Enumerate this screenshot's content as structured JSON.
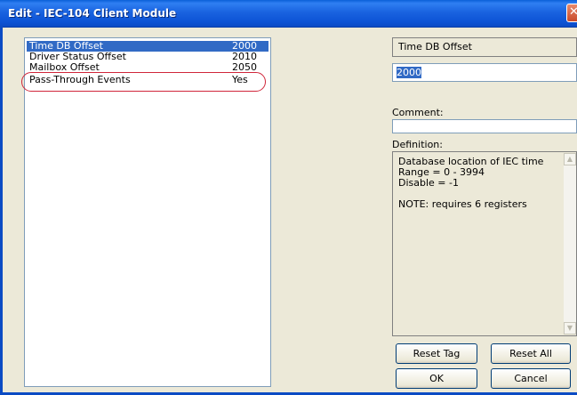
{
  "window": {
    "title": "Edit - IEC-104 Client Module",
    "close_glyph": "✕"
  },
  "params": [
    {
      "name": "Time DB Offset",
      "value": "2000",
      "selected": true
    },
    {
      "name": "Driver Status Offset",
      "value": "2010"
    },
    {
      "name": "Mailbox Offset",
      "value": "2050"
    },
    {
      "name": "Pass-Through Events",
      "value": "Yes"
    }
  ],
  "editor": {
    "field_name": "Time DB Offset",
    "value": "2000",
    "comment_label": "Comment:",
    "comment_value": "",
    "definition_label": "Definition:",
    "definition_text": "Database location of IEC time\nRange = 0 - 3994\nDisable = -1\n\nNOTE: requires 6 registers"
  },
  "buttons": {
    "reset_tag": "Reset Tag",
    "reset_all": "Reset All",
    "ok": "OK",
    "cancel": "Cancel"
  },
  "colors": {
    "selection": "#316ac5",
    "highlight_oval": "#d0263a",
    "title_bar": "#0d54d6"
  }
}
